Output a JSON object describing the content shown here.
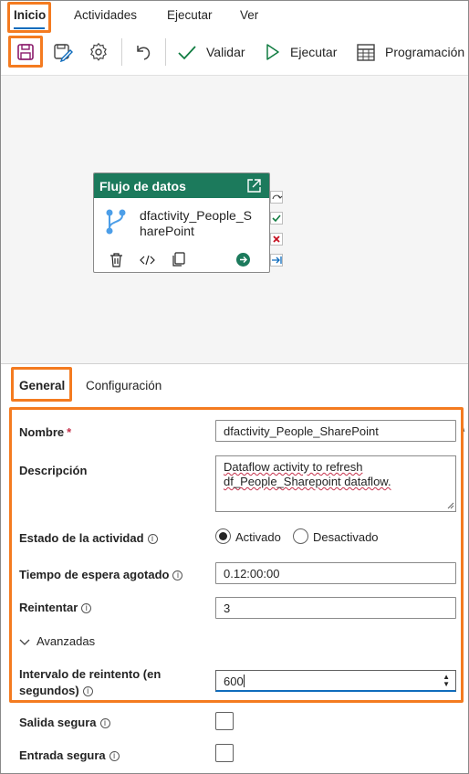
{
  "menu": {
    "items": [
      "Inicio",
      "Actividades",
      "Ejecutar",
      "Ver"
    ]
  },
  "toolbar": {
    "validate_label": "Validar",
    "run_label": "Ejecutar",
    "schedule_label": "Programación",
    "icons": [
      "save-icon",
      "save-as-icon",
      "gear-icon",
      "undo-icon",
      "checkmark-icon",
      "play-icon",
      "calendar-icon"
    ]
  },
  "activity": {
    "header": "Flujo de datos",
    "name": "dfactivity_People_SharePoint",
    "icons": [
      "external-link-icon",
      "dataflow-icon",
      "delete-icon",
      "code-icon",
      "copy-icon",
      "arrow-right-icon"
    ]
  },
  "tabs": [
    "General",
    "Configuración"
  ],
  "form": {
    "name_label": "Nombre",
    "name_value": "dfactivity_People_SharePoint",
    "description_label": "Descripción",
    "description_value": "Dataflow activity to refresh df_People_Sharepoint dataflow.",
    "status_label": "Estado de la actividad",
    "status_on": "Activado",
    "status_off": "Desactivado",
    "status_selected": "Activado",
    "timeout_label": "Tiempo de espera agotado",
    "timeout_value": "0.12:00:00",
    "retry_label": "Reintentar",
    "retry_value": "3",
    "advanced_label": "Avanzadas",
    "retry_interval_label": "Intervalo de reintento (en segundos)",
    "retry_interval_value": "600",
    "secure_output_label": "Salida segura",
    "secure_input_label": "Entrada segura"
  },
  "colors": {
    "accent": "#0f6cbd",
    "activity_header": "#1c7a5c",
    "highlight": "#f47b20",
    "required": "#c4314b"
  }
}
